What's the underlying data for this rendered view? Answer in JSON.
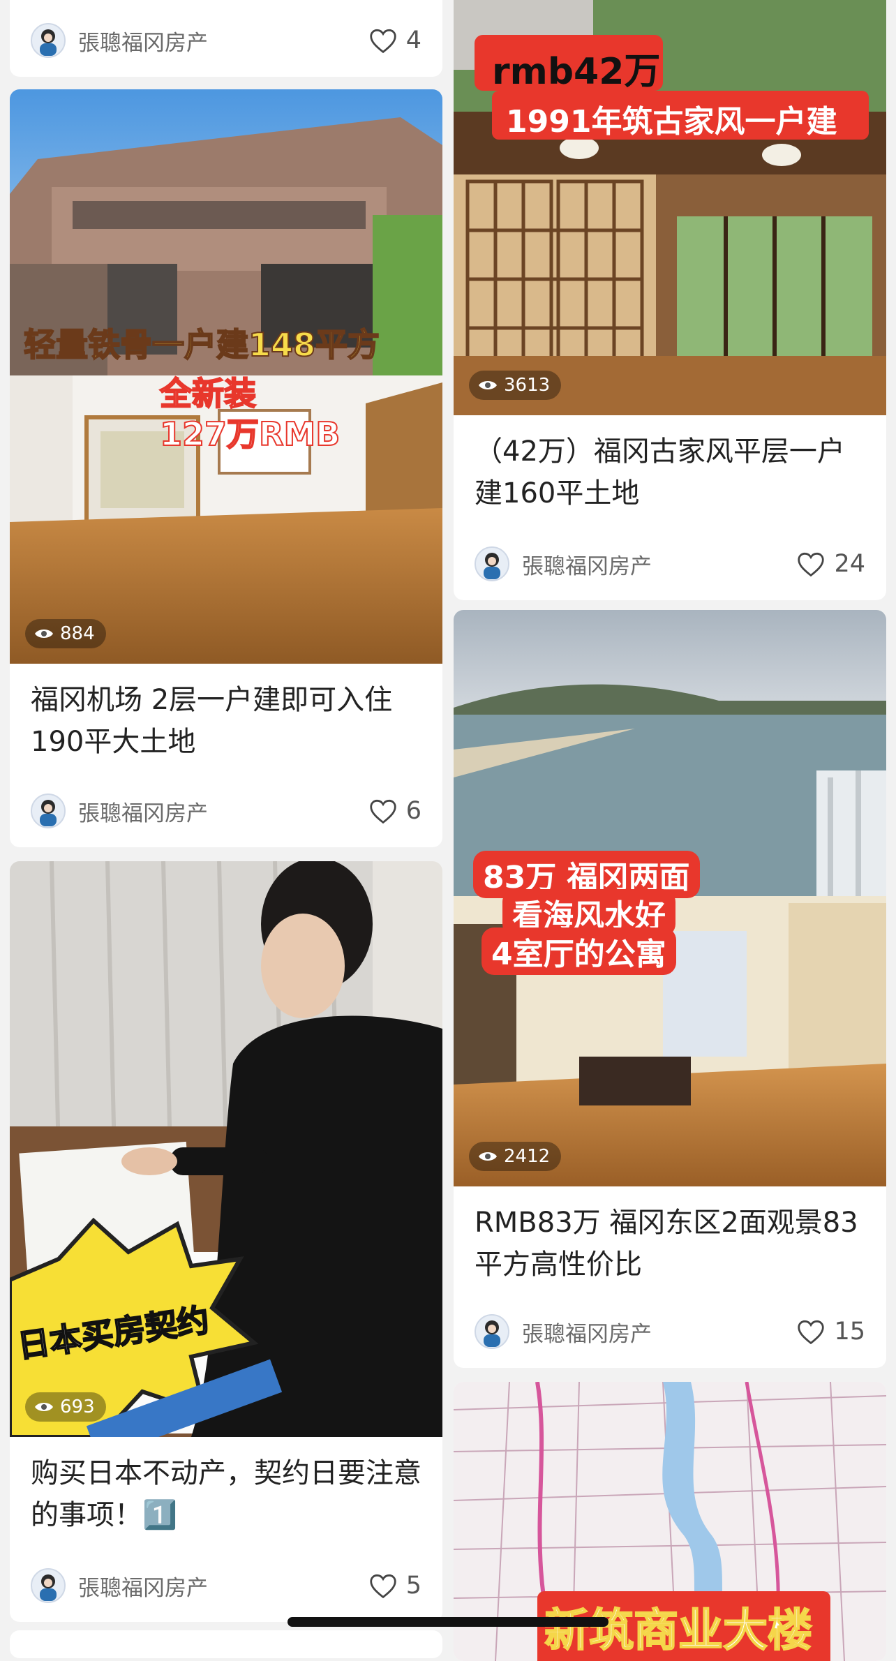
{
  "colors": {
    "accent_red": "#e8372c",
    "overlay_yellow": "#f5d64a",
    "background": "#f2f2f2"
  },
  "author_name": "張聰福冈房产",
  "cards": [
    {
      "id": "c1",
      "title": "",
      "views": "",
      "likes": "4",
      "overlay": []
    },
    {
      "id": "c2",
      "title": "福冈机场 2层一户建即可入住190平大土地",
      "views": "884",
      "likes": "6",
      "overlay": [
        "轻量铁骨一户建148平方",
        "全新装",
        "127万RMB"
      ]
    },
    {
      "id": "c3",
      "title": "购买日本不动产，契约日要注意的事项！1️⃣",
      "views": "693",
      "likes": "5",
      "overlay": [
        "日本买房契约"
      ]
    },
    {
      "id": "c4",
      "title": "（42万）福冈古家风平层一户建160平土地",
      "views": "3613",
      "likes": "24",
      "overlay": [
        "rmb42万",
        "1991年筑古家风一户建"
      ]
    },
    {
      "id": "c5",
      "title": "RMB83万 福冈东区2面观景83平方高性价比",
      "views": "2412",
      "likes": "15",
      "overlay": [
        "83万 福冈两面",
        "看海风水好",
        "4室厅的公寓"
      ]
    },
    {
      "id": "c6",
      "title": "",
      "views": "",
      "likes": "",
      "overlay": [
        "新筑商业大楼"
      ]
    }
  ]
}
